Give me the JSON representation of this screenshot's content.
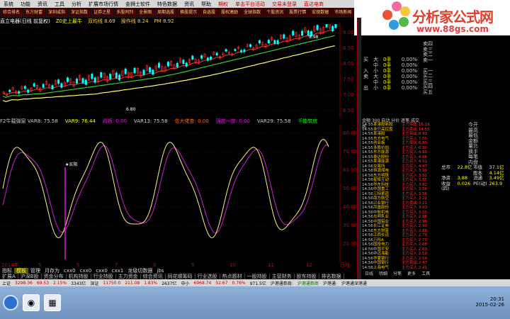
{
  "menubar": [
    "系统",
    "功能",
    "资讯",
    "工具",
    "分析",
    "扩展市场行情",
    "金狮士软件",
    "特色数据",
    "资讯",
    "帮助",
    "期权",
    "单击平台活动",
    "交易未登录",
    "直达电商"
  ],
  "toolbar": [
    "综合排名",
    "东方财富",
    "深圳成指",
    "深证指数",
    "证券之星",
    "多股同列",
    "全景图",
    "周期选股",
    "换股提示",
    "自选股",
    "股权激励",
    "全球指数",
    "个股资讯",
    "股票行情",
    "宏观数据",
    "市场新闻",
    "扫扫全文"
  ],
  "logo": {
    "title": "分析家公式网",
    "url": "www.88gs.com"
  },
  "infobar": [
    "直立电器(日线 前复权)",
    "Z0史上最牛",
    "双均线 8.69",
    "操作线 8.24",
    "PM 8.92"
  ],
  "main_axis": [
    "9.00",
    "8.50",
    "8.00",
    "7.50",
    "7.00",
    "6.50"
  ],
  "main_labels": {
    "high": "8.98",
    "low": "6.80"
  },
  "ind_header": [
    "F2牛载弹窗 VAR8: 75.58",
    "VAR9: 76.44",
    "跳板: 0.00",
    "VAR13: 75.58",
    "佐大佬查: 0.00",
    "强度一度: 0.00",
    "VAR29: 75.58",
    "千能筑底"
  ],
  "ind_axis": [
    "80.00",
    "70.00",
    "60.00",
    "50.00",
    "40.00",
    "30.00",
    "20.00"
  ],
  "ind_label": "买阳",
  "xaxis": [
    "2014年",
    "5",
    "6",
    "7",
    "8",
    "9",
    "10",
    "11",
    "12",
    "日线"
  ],
  "tabs1": [
    "指标",
    "模板",
    "管理",
    "月存为",
    "cxx0",
    "cxx0",
    "cxx0",
    "cxx1",
    "龙级切数据",
    "jbs"
  ],
  "tabs2": [
    "扩展A",
    "沪深B股",
    "资金分布",
    "机构持股",
    "行业持股",
    "主力资金",
    "综合资讯",
    "同花顺筹码",
    "行业选股",
    "热点题材",
    "一股持股",
    "主营财务",
    "股东持股",
    "排名数据"
  ],
  "orderbook": {
    "rows": [
      {
        "lbl": "买",
        "nm": "大",
        "vol": "0手",
        "pct": "0.00%"
      },
      {
        "lbl": "",
        "nm": "中",
        "vol": "0手",
        "pct": "0.00%"
      },
      {
        "lbl": "入",
        "nm": "小",
        "vol": "0手",
        "pct": "0.00%"
      },
      {
        "lbl": "卖",
        "nm": "大",
        "vol": "0手",
        "pct": "0.00%"
      },
      {
        "lbl": "",
        "nm": "中",
        "vol": "0手",
        "pct": "0.00%"
      },
      {
        "lbl": "出",
        "nm": "小",
        "vol": "0手",
        "pct": "0.00%"
      }
    ]
  },
  "side_labels": [
    "卖四",
    "卖三",
    "卖二",
    "卖一",
    "",
    "买一",
    "买二",
    "买三",
    "买四",
    "买五"
  ],
  "panel_tabs": "金额 300 自动 分价 逐笔 成交 热",
  "trades": [
    [
      "14:55",
      "某港股新股",
      "主力卖出 16.19"
    ],
    [
      "14:55",
      "多只高控盘",
      "主力卖出 14.55"
    ],
    [
      "14:55",
      "某港股",
      "主力卖出 8.91"
    ],
    [
      "14:55",
      "东方电气",
      "主力买入 7.00"
    ],
    [
      "14:55",
      "创业板",
      "主力卖出 6.89"
    ],
    [
      "14:55",
      "多股价加",
      "主力买入 6.30"
    ],
    [
      "14:55",
      "东方能源",
      "主力买入 4.89"
    ],
    [
      "14:55",
      "泰达股份",
      "主力买入 4.86"
    ],
    [
      "14:55",
      "某港能源",
      "主力买入 4.51"
    ],
    [
      "14:56",
      "交易所",
      "主力买入 4.47"
    ],
    [
      "14:56",
      "恒源煤电",
      "主力买入 3.99"
    ],
    [
      "14:56",
      "东方明珠",
      "主力买入 3.91"
    ],
    [
      "14:56",
      "星辉互动",
      "主力买入 3.85"
    ],
    [
      "14:56",
      "华东科技",
      "主力买入 3.82"
    ],
    [
      "14:56",
      "中国重工",
      "主力买入 3.56"
    ],
    [
      "14:56",
      "三特索道",
      "主力买入 3.56"
    ],
    [
      "14:56",
      "南方航空",
      "主力买入 3.21"
    ],
    [
      "14:56",
      "兴业银行",
      "主力卖出 3.11"
    ],
    [
      "14:56",
      "凤凰股份",
      "主力买入 3.03"
    ],
    [
      "14:56",
      "中航机电",
      "主力买入 3.00"
    ],
    [
      "14:56",
      "光明乳业",
      "主力买入 2.98"
    ],
    [
      "14:56",
      "中国铝业",
      "主力买入 2.96"
    ],
    [
      "14:56",
      "长江证券",
      "主力买入 2.90"
    ],
    [
      "14:56",
      "东方财富",
      "主力买入 2.88"
    ],
    [
      "14:56",
      "江西长运",
      "主力买入 2.79"
    ],
    [
      "14:56",
      "万科A",
      "主力买入 2.70"
    ],
    [
      "14:56",
      "国投电力",
      "主力买入 2.68"
    ],
    [
      "14:56",
      "中国平安",
      "主力买入 2.63"
    ],
    [
      "14:56",
      "中远海能",
      "主力买入 2.59"
    ],
    [
      "14:56",
      "华夏银行",
      "主力买入 2.54"
    ],
    [
      "14:56",
      "中国银行",
      "主力卖出 2.47"
    ],
    [
      "14:56",
      "上海电气",
      "主力买入 2.41"
    ]
  ],
  "quote_labels": [
    "今开",
    "最高",
    "最低",
    "金额",
    "量比",
    "换手",
    "每笔",
    "内盘"
  ],
  "quote_values": [
    [
      "总市",
      "22.8亿",
      "市值",
      "37.1亿"
    ],
    [
      "",
      "",
      "股本",
      "4.14亿"
    ],
    [
      "净资",
      "3.88",
      "流通",
      "3.49亿"
    ],
    [
      "收益(四)",
      "0.026",
      "PE(动)",
      "263.9"
    ]
  ],
  "right_bottom": [
    "日线",
    "明细",
    "分笔",
    "更多",
    "工具"
  ],
  "status": [
    {
      "t": "上证",
      "c": ""
    },
    {
      "t": "3298.36",
      "c": "r"
    },
    {
      "t": "69.53",
      "c": "r"
    },
    {
      "t": "2.15%",
      "c": "r"
    },
    {
      "t": "3343亿",
      "c": ""
    },
    {
      "t": "深证",
      "c": ""
    },
    {
      "t": "11750.0",
      "c": "r"
    },
    {
      "t": "211.08",
      "c": "r"
    },
    {
      "t": "1.83%",
      "c": "r"
    },
    {
      "t": "2637亿",
      "c": ""
    },
    {
      "t": "中小",
      "c": ""
    },
    {
      "t": "6968.74",
      "c": "r"
    },
    {
      "t": "52.67",
      "c": "r"
    },
    {
      "t": "0.76%",
      "c": "r"
    },
    {
      "t": "971.5亿",
      "c": ""
    },
    {
      "t": "沪港通券商:",
      "c": ""
    },
    {
      "t": "沪港通券商",
      "c": "g"
    },
    {
      "t": "沪港通:",
      "c": ""
    },
    {
      "t": "沪港通深港通",
      "c": ""
    }
  ],
  "clock": {
    "time": "20:31",
    "date": "2015-02-26"
  }
}
